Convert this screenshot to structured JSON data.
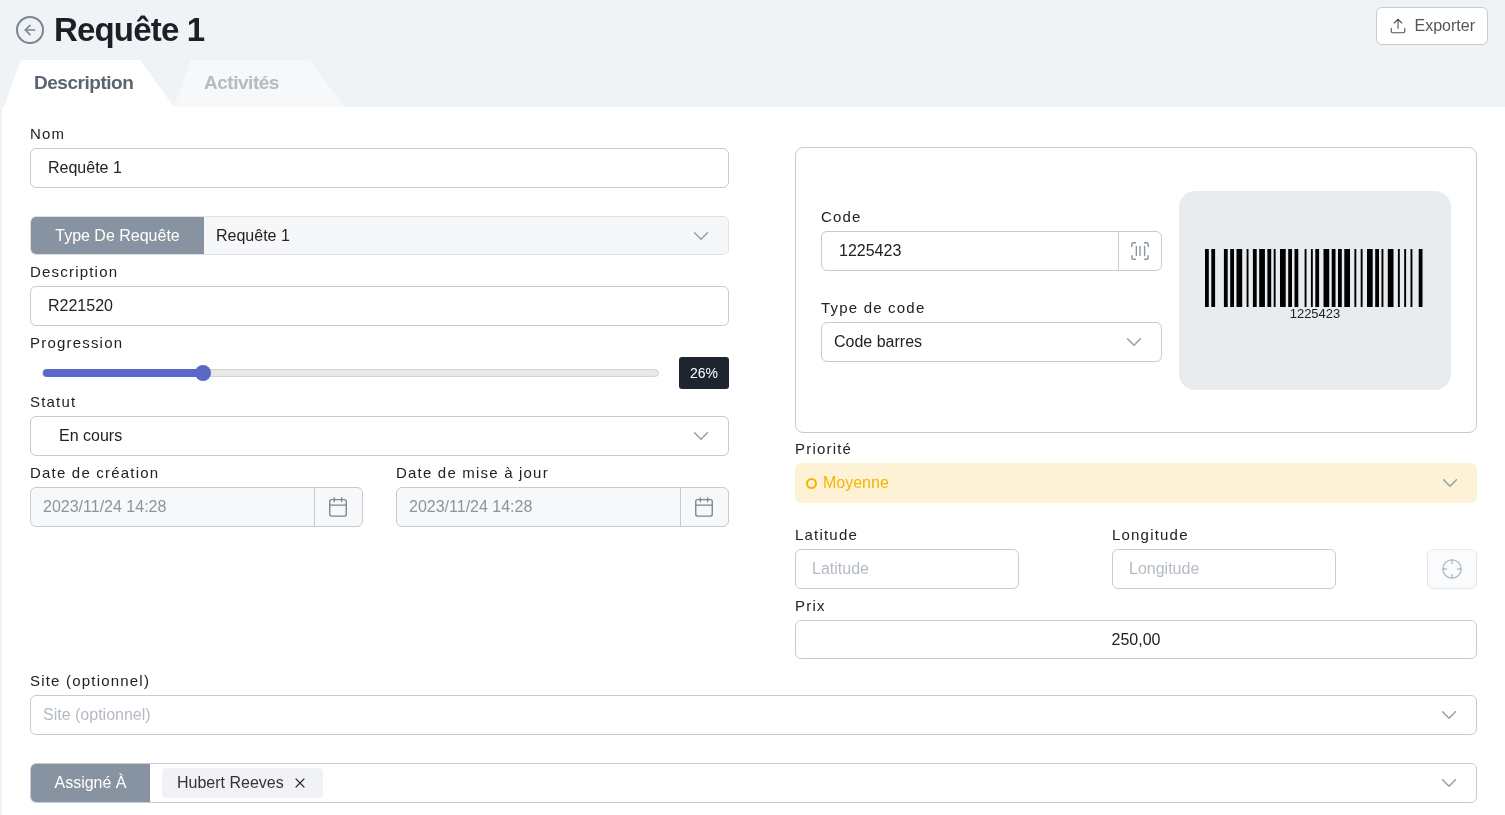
{
  "page": {
    "title": "Requête 1",
    "export_button": "Exporter"
  },
  "tabs": [
    {
      "label": "Description",
      "selected": true
    },
    {
      "label": "Activités",
      "selected": false
    }
  ],
  "form": {
    "name": {
      "label": "Nom",
      "value": "Requête 1"
    },
    "request_type": {
      "label": "Type De Requête",
      "value": "Requête 1"
    },
    "description": {
      "label": "Description",
      "value": "R221520"
    },
    "progression": {
      "label": "Progression",
      "level": 0.26,
      "reading": "26%"
    },
    "status": {
      "label": "Statut",
      "value": "En cours"
    },
    "dates": [
      {
        "label": "Date de création",
        "value": "2023/11/24 14:28",
        "disabled": true
      },
      {
        "label": "Date de mise à jour",
        "value": "2023/11/24 14:28",
        "disabled": true
      }
    ],
    "code": {
      "label": "Code",
      "value": "1225423",
      "barcode_caption": "1225423"
    },
    "code_type": {
      "label": "Type de code",
      "value": "Code barres"
    },
    "priority": {
      "label": "Priorité",
      "value": "Moyenne",
      "color": "#f5b400"
    },
    "latitude": {
      "label": "Latitude",
      "placeholder": "Latitude"
    },
    "longitude": {
      "label": "Longitude",
      "placeholder": "Longitude"
    },
    "price": {
      "label": "Prix",
      "value": "250,00"
    },
    "site": {
      "label": "Site (optionnel)",
      "placeholder": "Site (optionnel)"
    },
    "assigned": {
      "label": "Assigné À",
      "chips": [
        "Hubert Reeves"
      ]
    }
  }
}
